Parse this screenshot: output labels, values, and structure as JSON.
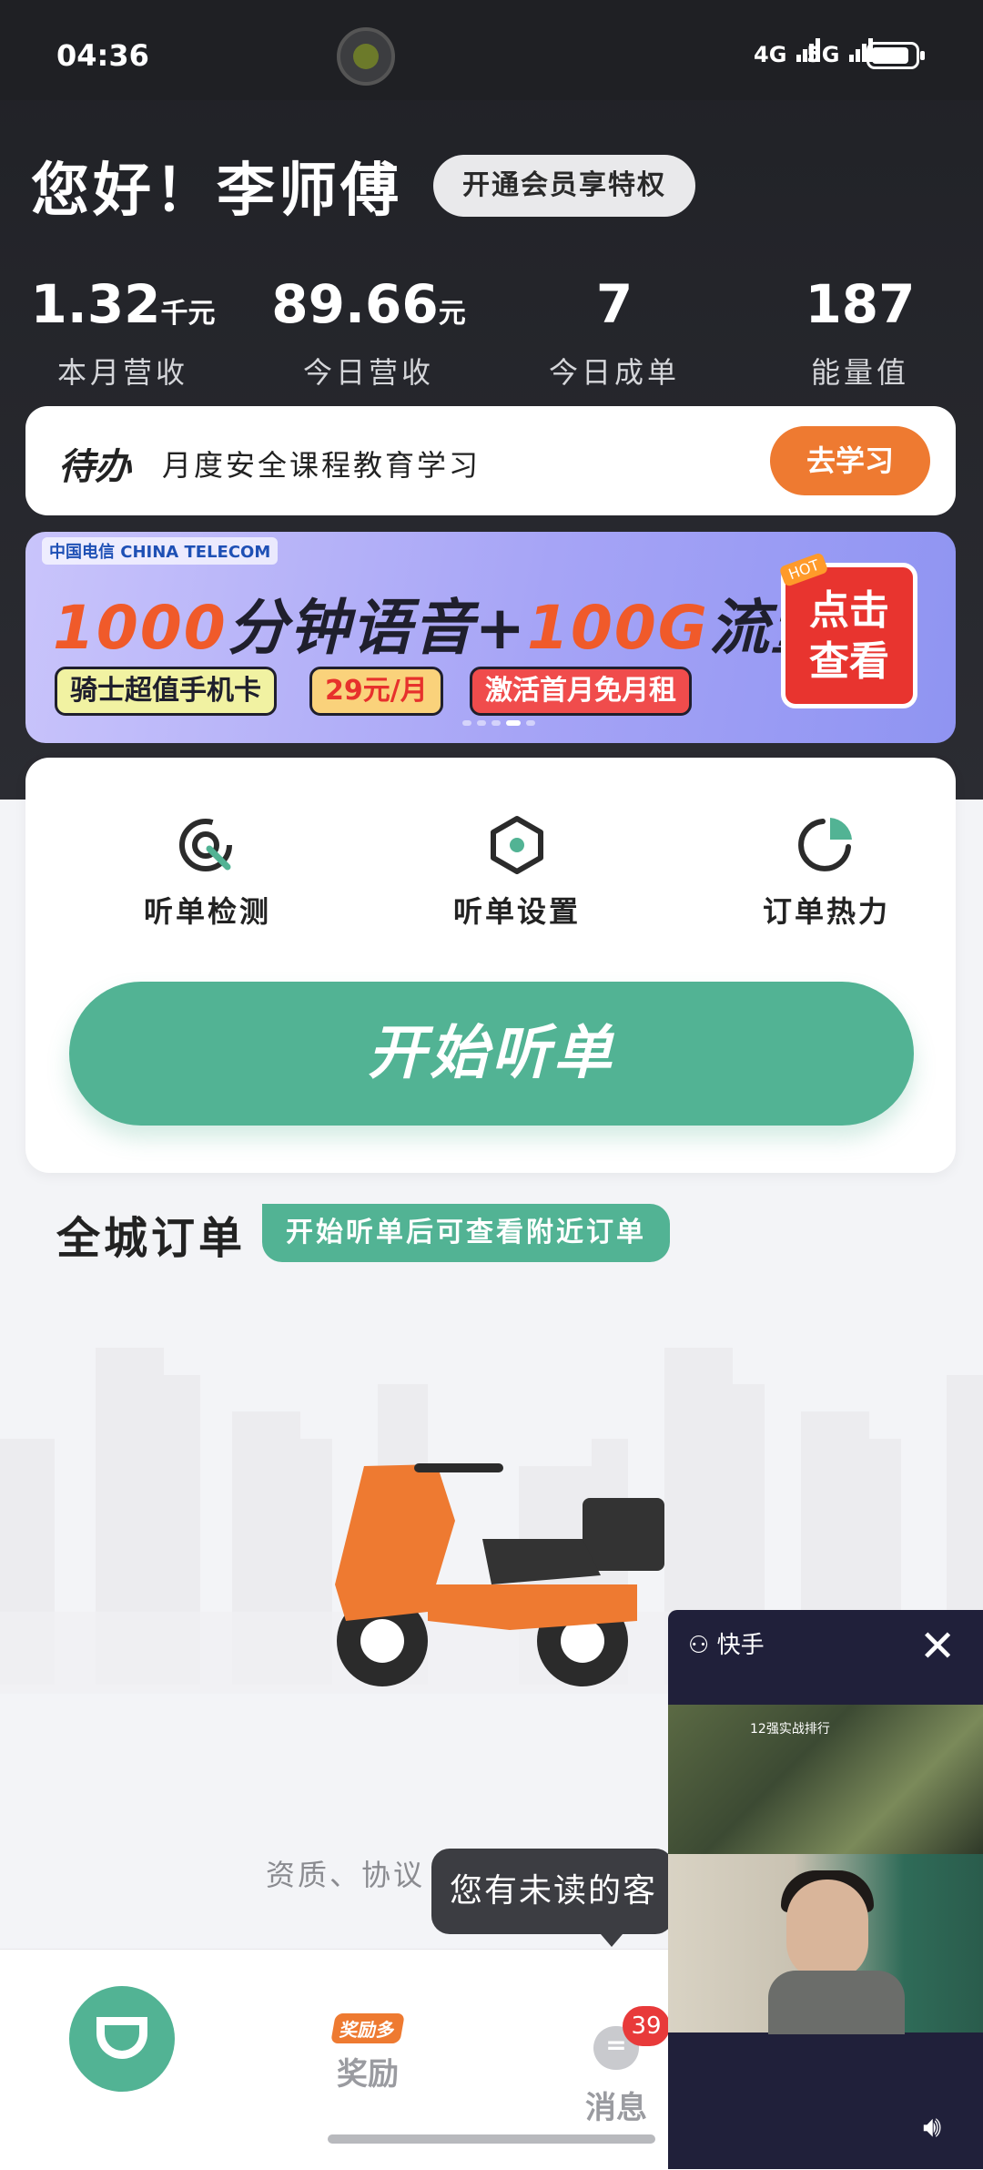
{
  "status_bar": {
    "time": "04:36",
    "signal_1": "4G",
    "signal_2": "5G"
  },
  "header": {
    "greeting": "您好！李师傅",
    "vip_button": "开通会员享特权"
  },
  "stats": [
    {
      "value": "1.32",
      "unit": "千元",
      "label": "本月营收"
    },
    {
      "value": "89.66",
      "unit": "元",
      "label": "今日营收"
    },
    {
      "value": "7",
      "unit": "",
      "label": "今日成单"
    },
    {
      "value": "187",
      "unit": "",
      "label": "能量值"
    }
  ],
  "todo": {
    "badge": "待办",
    "text": "月度安全课程教育学习",
    "button": "去学习"
  },
  "banner": {
    "logo": "中国电信 CHINA TELECOM",
    "headline_num1": "1000",
    "headline_mid": "分钟语音+",
    "headline_num2": "100G",
    "headline_end": "流量",
    "tag1": "骑士超值手机卡",
    "tag2": "29元/月",
    "tag3": "激活首月免月租",
    "cta_line1": "点击",
    "cta_line2": "查看",
    "hot": "HOT"
  },
  "functions": [
    {
      "icon": "radar-icon",
      "label": "听单检测"
    },
    {
      "icon": "hexagon-settings-icon",
      "label": "听单设置"
    },
    {
      "icon": "pie-chart-icon",
      "label": "订单热力"
    }
  ],
  "start_button": "开始听单",
  "city_orders": {
    "title": "全城订单",
    "tip": "开始听单后可查看附近订单"
  },
  "footer_links": "资质、协议 | 业务规则 | 客服",
  "tooltip": "您有未读的客",
  "tabbar": {
    "reward_badge": "奖励多",
    "reward_label": "奖励",
    "message_label": "消息",
    "message_count": "39"
  },
  "floating_video": {
    "app_name": "快手",
    "game_overlay": "12强实战排行"
  },
  "colors": {
    "accent": "#52b394",
    "orange": "#ee7a31",
    "dark": "#202126"
  }
}
